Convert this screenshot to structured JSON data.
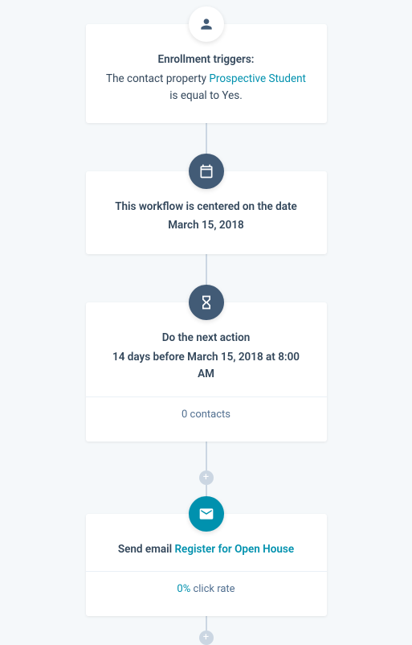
{
  "enrollment": {
    "title": "Enrollment triggers:",
    "prefix": "The contact property ",
    "property_link": "Prospective Student",
    "suffix": " is equal to Yes."
  },
  "center_date": {
    "line1": "This workflow is centered on the date",
    "line2": "March 15, 2018"
  },
  "delay": {
    "line1": "Do the next action",
    "line2": "14 days before March 15, 2018 at 8:00 AM",
    "contacts": "0 contacts"
  },
  "send_email": {
    "prefix": "Send email ",
    "link": "Register for Open House",
    "rate_value": "0%",
    "rate_label": " click rate"
  },
  "plus_glyph": "+"
}
